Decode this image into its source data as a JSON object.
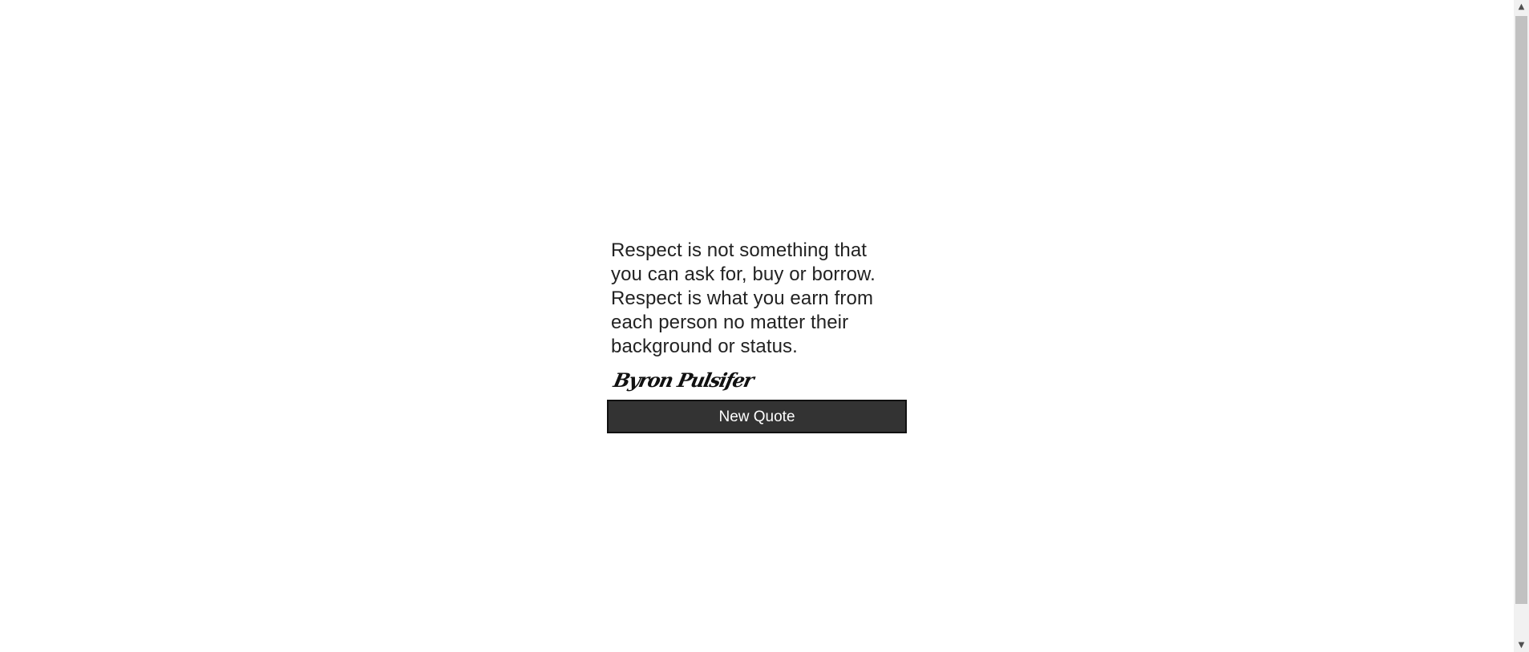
{
  "quote": {
    "text": "Respect is not something that you can ask for, buy or borrow. Respect is what you earn from each person no matter their background or status.",
    "author": "Byron Pulsifer"
  },
  "actions": {
    "new_quote_label": "New Quote"
  },
  "scrollbar": {
    "up_arrow": "▲",
    "down_arrow": "▼"
  }
}
